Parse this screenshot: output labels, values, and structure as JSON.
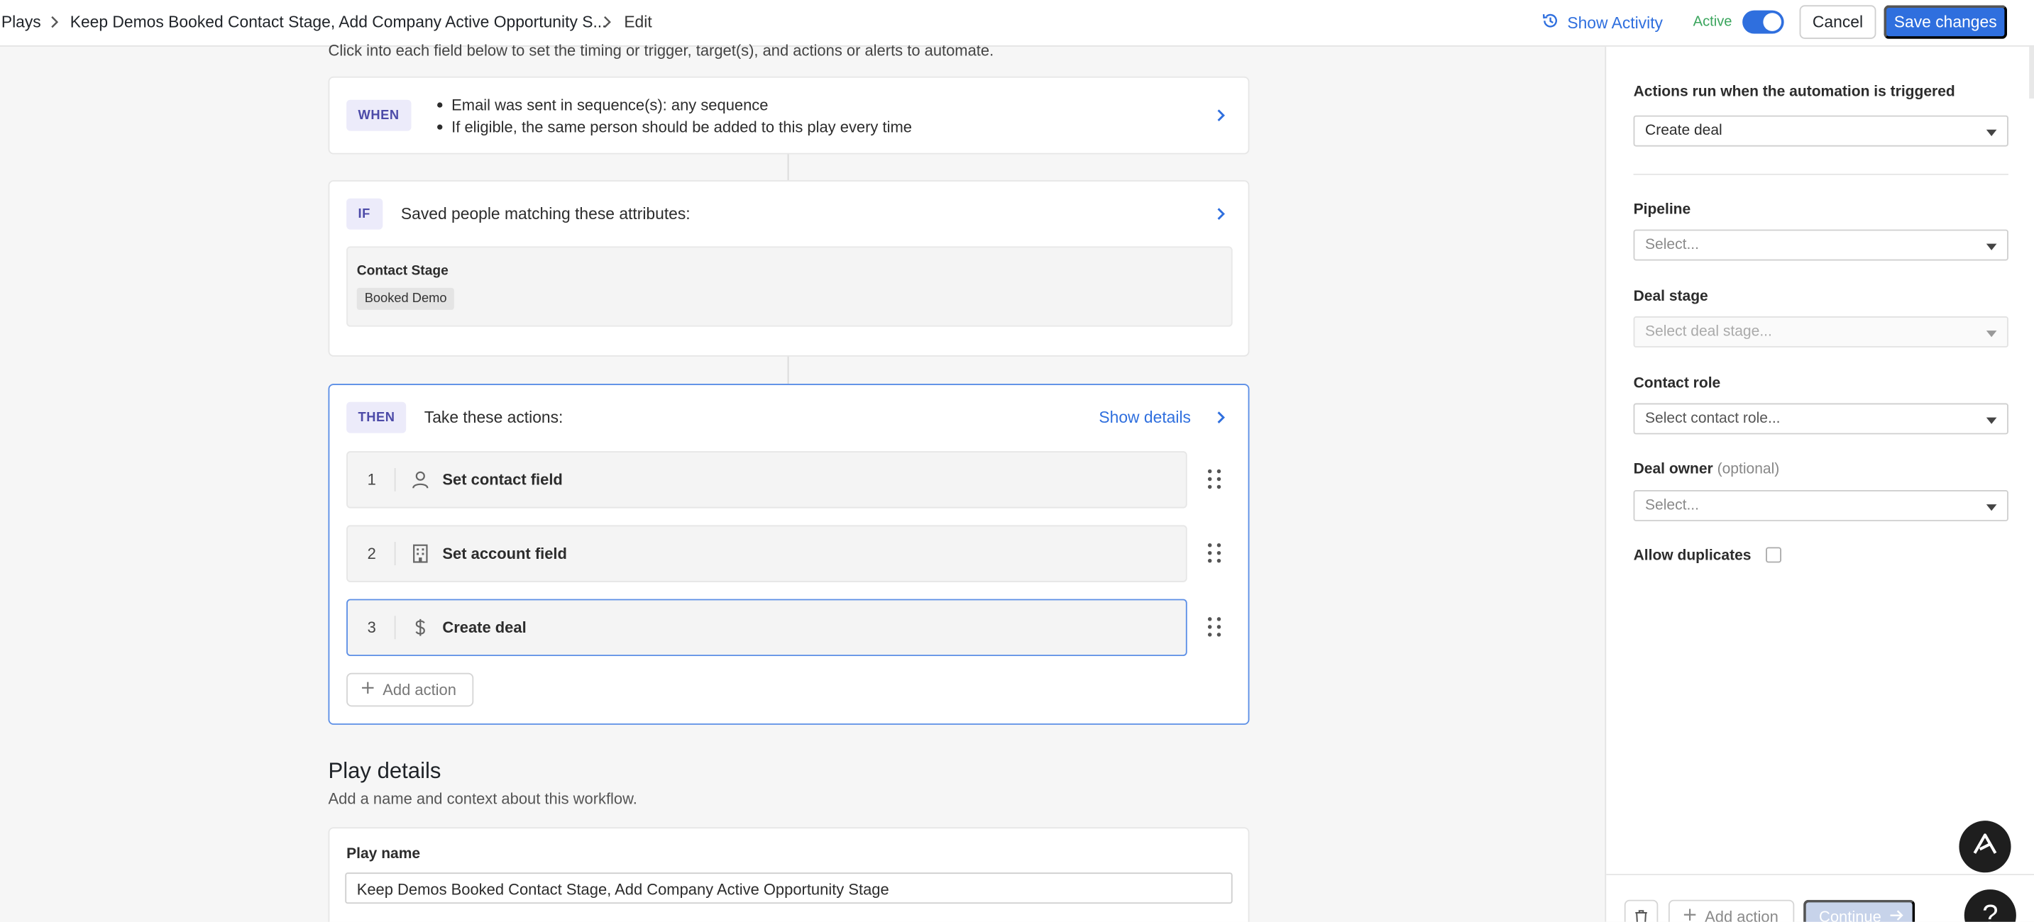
{
  "breadcrumb": {
    "root": "Plays",
    "play_title": "Keep Demos Booked Contact Stage, Add Company Active Opportunity S...",
    "current": "Edit"
  },
  "header": {
    "show_activity": "Show Activity",
    "status_label": "Active",
    "cancel": "Cancel",
    "save": "Save changes"
  },
  "intro": "Click into each field below to set the timing or trigger, target(s), and actions or alerts to automate.",
  "when": {
    "chip": "WHEN",
    "items": [
      "Email was sent in sequence(s): any sequence",
      "If eligible, the same person should be added to this play every time"
    ]
  },
  "if": {
    "chip": "IF",
    "title": "Saved people matching these attributes:",
    "attr_label": "Contact Stage",
    "attr_value": "Booked Demo"
  },
  "then": {
    "chip": "THEN",
    "title": "Take these actions:",
    "show_details": "Show details",
    "actions": [
      {
        "num": "1",
        "label": "Set contact field",
        "icon": "person-icon"
      },
      {
        "num": "2",
        "label": "Set account field",
        "icon": "building-icon"
      },
      {
        "num": "3",
        "label": "Create deal",
        "icon": "dollar-icon"
      }
    ],
    "add_action": "Add action"
  },
  "play_details": {
    "title": "Play details",
    "subtitle": "Add a name and context about this workflow.",
    "name_label": "Play name",
    "name_value": "Keep Demos Booked Contact Stage, Add Company Active Opportunity Stage"
  },
  "panel": {
    "title": "Actions run when the automation is triggered",
    "action_type": "Create deal",
    "pipeline_label": "Pipeline",
    "pipeline_placeholder": "Select...",
    "deal_stage_label": "Deal stage",
    "deal_stage_placeholder": "Select deal stage...",
    "contact_role_label": "Contact role",
    "contact_role_placeholder": "Select contact role...",
    "deal_owner_label": "Deal owner",
    "deal_owner_optional": "(optional)",
    "deal_owner_placeholder": "Select...",
    "allow_duplicates": "Allow duplicates",
    "add_action": "Add action",
    "continue": "Continue"
  },
  "colors": {
    "accent": "#2f6fde",
    "active_green": "#3aa55d",
    "chip_bg": "#ecebfa",
    "chip_text": "#4c4aa8"
  }
}
